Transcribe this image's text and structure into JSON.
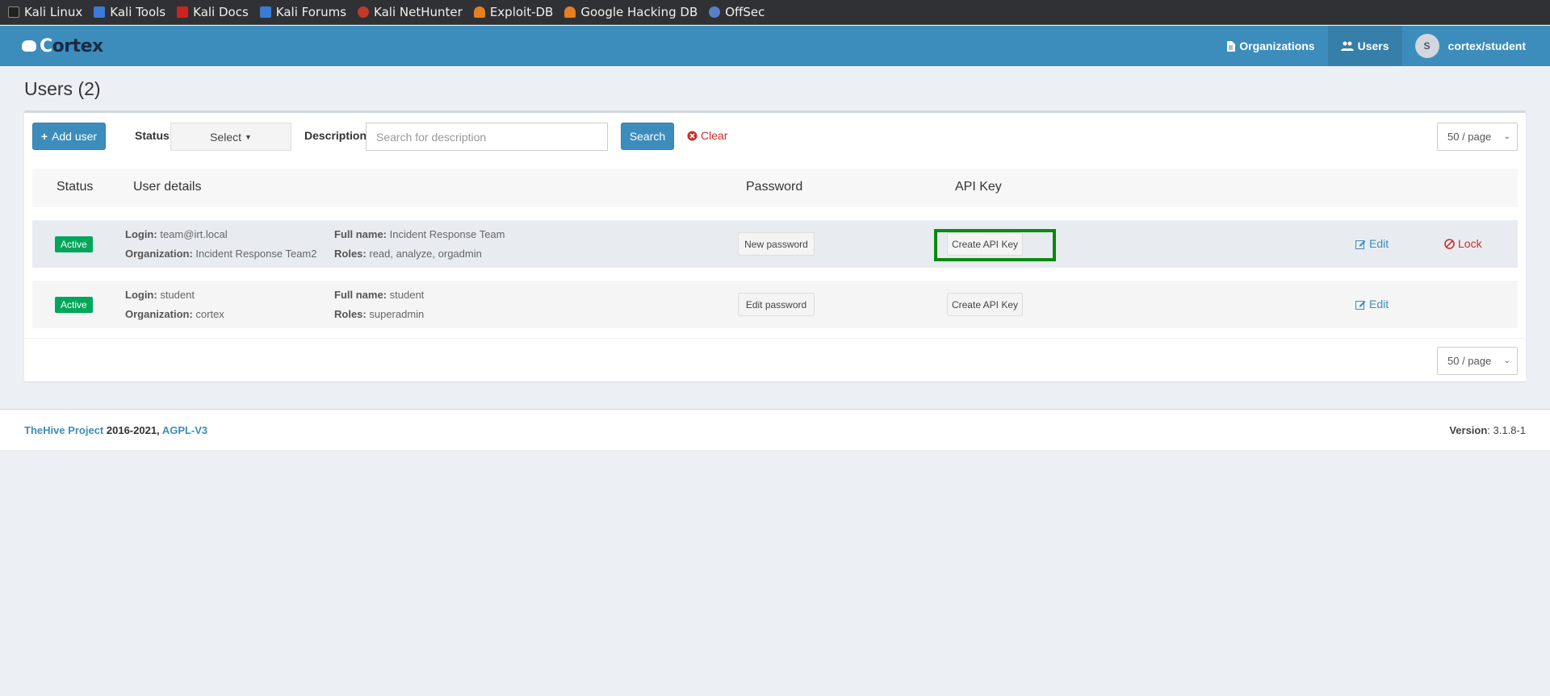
{
  "bookmarks": [
    {
      "label": "Kali Linux",
      "icon": "kali-dragon-icon",
      "color": "#1c1c1c"
    },
    {
      "label": "Kali Tools",
      "icon": "kali-tools-icon",
      "color": "#d33"
    },
    {
      "label": "Kali Docs",
      "icon": "kali-docs-icon",
      "color": "#c22"
    },
    {
      "label": "Kali Forums",
      "icon": "kali-forums-icon",
      "color": "#3a7bd5"
    },
    {
      "label": "Kali NetHunter",
      "icon": "nethunter-icon",
      "color": "#c0392b"
    },
    {
      "label": "Exploit-DB",
      "icon": "exploit-db-icon",
      "color": "#e67e22"
    },
    {
      "label": "Google Hacking DB",
      "icon": "ghdb-icon",
      "color": "#e67e22"
    },
    {
      "label": "OffSec",
      "icon": "offsec-icon",
      "color": "#5b7fc7"
    }
  ],
  "navbar": {
    "logo_prefix": "C",
    "logo_rest": "ortex",
    "organizations": "Organizations",
    "users": "Users",
    "avatar_letter": "S",
    "user": "cortex/student"
  },
  "page": {
    "title": "Users (2)"
  },
  "toolbar": {
    "add_user": "Add user",
    "status_label": "Status",
    "status_select": "Select",
    "description_label": "Description",
    "description_placeholder": "Search for description",
    "search": "Search",
    "clear": "Clear",
    "page_size": "50 / page"
  },
  "table": {
    "headers": {
      "status": "Status",
      "user_details": "User details",
      "password": "Password",
      "api_key": "API Key"
    },
    "labels": {
      "login": "Login:",
      "organization": "Organization:",
      "full_name": "Full name:",
      "roles": "Roles:"
    },
    "rows": [
      {
        "status": "Active",
        "login": "team@irt.local",
        "organization": "Incident Response Team2",
        "full_name": "Incident Response Team",
        "roles": "read, analyze, orgadmin",
        "password_action": "New password",
        "api_action": "Create API Key",
        "edit": "Edit",
        "lock": "Lock"
      },
      {
        "status": "Active",
        "login": "student",
        "organization": "cortex",
        "full_name": "student",
        "roles": "superadmin",
        "password_action": "Edit password",
        "api_action": "Create API Key",
        "edit": "Edit"
      }
    ]
  },
  "footer": {
    "project": "TheHive Project",
    "years": "2016-2021,",
    "license": "AGPL-V3",
    "version_label": "Version",
    "version": ": 3.1.8-1"
  },
  "colors": {
    "navbar": "#3c8dbc",
    "active_badge": "#00a65a",
    "highlight": "#0a8a0a",
    "danger": "#c9302c"
  }
}
